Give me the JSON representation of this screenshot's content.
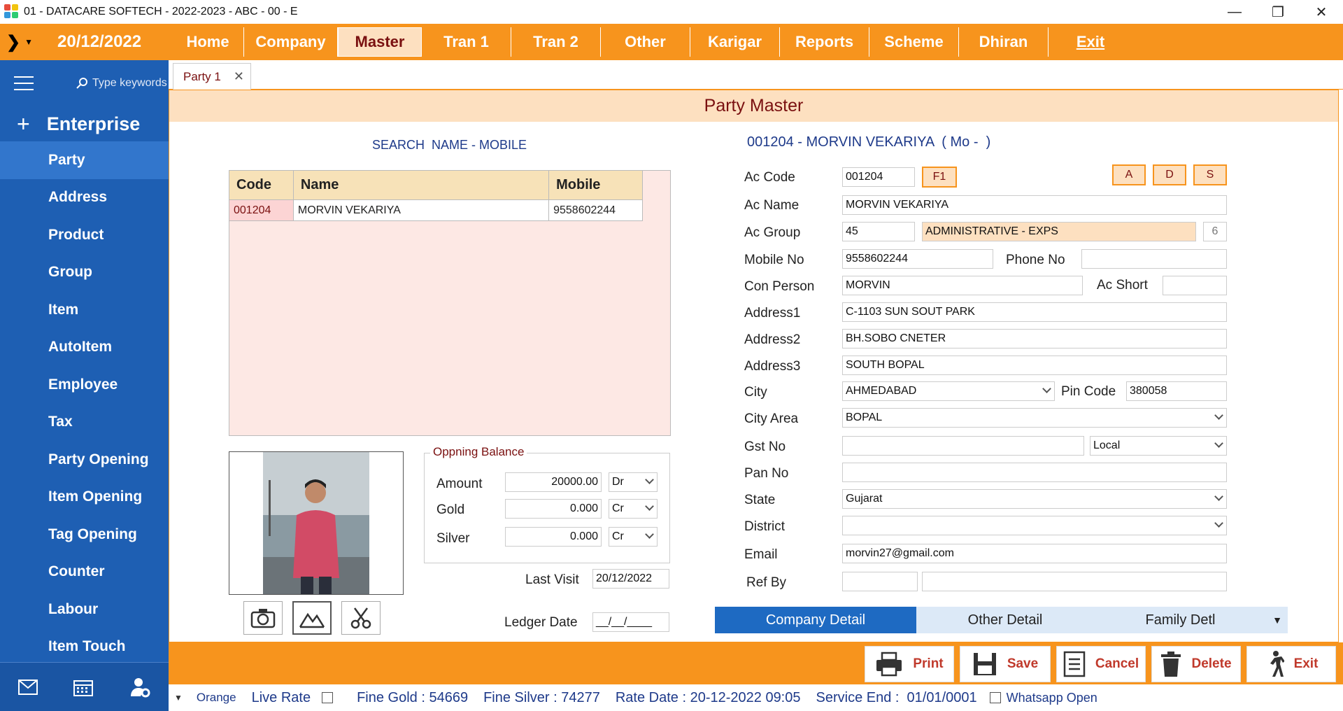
{
  "window": {
    "title": "01 - DATACARE SOFTECH - 2022-2023 - ABC - 00 - E"
  },
  "menubar": {
    "date": "20/12/2022",
    "items": [
      "Home",
      "Company",
      "Master",
      "Tran 1",
      "Tran 2",
      "Other",
      "Karigar",
      "Reports",
      "Scheme",
      "Dhiran",
      "Exit"
    ],
    "active": "Master"
  },
  "sidebar": {
    "search_placeholder": "Type keywords",
    "section": "Enterprise",
    "items": [
      "Party",
      "Address",
      "Product",
      "Group",
      "Item",
      "AutoItem",
      "Employee",
      "Tax",
      "Party Opening",
      "Item Opening",
      "Tag Opening",
      "Counter",
      "Labour",
      "Item Touch"
    ],
    "selected": "Party"
  },
  "tab": {
    "label": "Party 1"
  },
  "page": {
    "title": "Party Master"
  },
  "search": {
    "label": "SEARCH  NAME - MOBILE",
    "columns": [
      "Code",
      "Name",
      "Mobile"
    ],
    "rows": [
      {
        "code": "001204",
        "name": "MORVIN VEKARIYA",
        "mobile": "9558602244"
      }
    ]
  },
  "opening": {
    "legend": "Oppning Balance",
    "amount_label": "Amount",
    "amount": "20000.00",
    "amount_type": "Dr",
    "gold_label": "Gold",
    "gold": "0.000",
    "gold_type": "Cr",
    "silver_label": "Silver",
    "silver": "0.000",
    "silver_type": "Cr"
  },
  "visit": {
    "last_visit_label": "Last Visit",
    "last_visit": "20/12/2022",
    "ledger_label": "Ledger Date",
    "ledger_date": "__/__/____"
  },
  "form": {
    "heading": "001204 - MORVIN VEKARIYA  ( Mo -  )",
    "ac_code_label": "Ac Code",
    "ac_code": "001204",
    "f1": "F1",
    "btn_a": "A",
    "btn_d": "D",
    "btn_s": "S",
    "ac_name_label": "Ac Name",
    "ac_name": "MORVIN VEKARIYA",
    "ac_group_label": "Ac Group",
    "ac_group_code": "45",
    "ac_group_name": "ADMINISTRATIVE - EXPS",
    "ac_group_num": "6",
    "mobile_label": "Mobile No",
    "mobile": "9558602244",
    "phone_label": "Phone No",
    "phone": "",
    "con_person_label": "Con Person",
    "con_person": "MORVIN",
    "ac_short_label": "Ac Short",
    "ac_short": "",
    "address1_label": "Address1",
    "address1": "C-1103 SUN SOUT PARK",
    "address2_label": "Address2",
    "address2": "BH.SOBO CNETER",
    "address3_label": "Address3",
    "address3": "SOUTH BOPAL",
    "city_label": "City",
    "city": "AHMEDABAD",
    "pin_label": "Pin Code",
    "pin": "380058",
    "city_area_label": "City Area",
    "city_area": "BOPAL",
    "gst_label": "Gst No",
    "gst": "",
    "gst_type": "Local",
    "pan_label": "Pan No",
    "pan": "",
    "state_label": "State",
    "state": "Gujarat",
    "district_label": "District",
    "district": "",
    "email_label": "Email",
    "email": "morvin27@gmail.com",
    "ref_label": "Ref By",
    "ref1": "",
    "ref2": ""
  },
  "subtabs": [
    "Company Detail",
    "Other Detail",
    "Family Detl"
  ],
  "actions": [
    "Print",
    "Save",
    "Cancel",
    "Delete",
    "Exit"
  ],
  "status": {
    "theme": "Orange",
    "live_rate": "Live Rate",
    "fine_gold": "Fine Gold : 54669",
    "fine_silver": "Fine Silver : 74277",
    "rate_date": "Rate Date : 20-12-2022 09:05",
    "service_end": "Service End :  01/01/0001",
    "whatsapp": "Whatsapp Open"
  },
  "colors": {
    "accent": "#f7941d",
    "sidebar": "#1e5fb3",
    "header_bg": "#fde0c0",
    "text_dark_red": "#7a1010"
  }
}
